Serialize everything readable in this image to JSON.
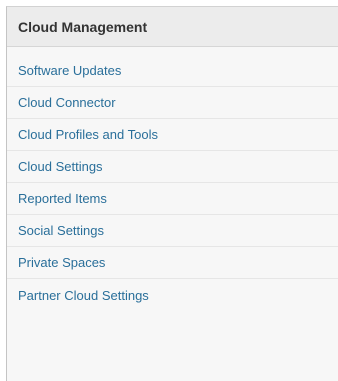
{
  "panel": {
    "title": "Cloud Management",
    "items": [
      {
        "label": "Software Updates"
      },
      {
        "label": "Cloud Connector"
      },
      {
        "label": "Cloud Profiles and Tools"
      },
      {
        "label": "Cloud Settings"
      },
      {
        "label": "Reported Items"
      },
      {
        "label": "Social Settings"
      },
      {
        "label": "Private Spaces"
      },
      {
        "label": "Partner Cloud Settings"
      }
    ]
  },
  "colors": {
    "link": "#2a6f9a",
    "title": "#333333",
    "header_bg": "#ececec",
    "panel_bg": "#f7f7f7"
  }
}
